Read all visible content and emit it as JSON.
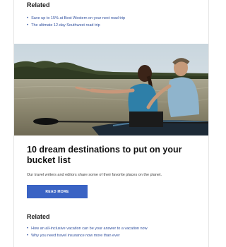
{
  "top_related": {
    "heading": "Related",
    "links": [
      "Save up to 15% at Best Western on your next road trip",
      "The ultimate 12-day Southwest road trip"
    ]
  },
  "hero": {
    "icon": "kayak-photo"
  },
  "article": {
    "title": "10 dream destinations to put on your bucket list",
    "description": "Our travel writers and editors share some of their favorite places on the planet.",
    "button_label": "READ MORE",
    "button_color": "#3a63c4"
  },
  "bottom_related": {
    "heading": "Related",
    "links": [
      "How an all-inclusive vacation can be your answer to a vacation now",
      "Why you need travel insurance now more than ever"
    ]
  }
}
